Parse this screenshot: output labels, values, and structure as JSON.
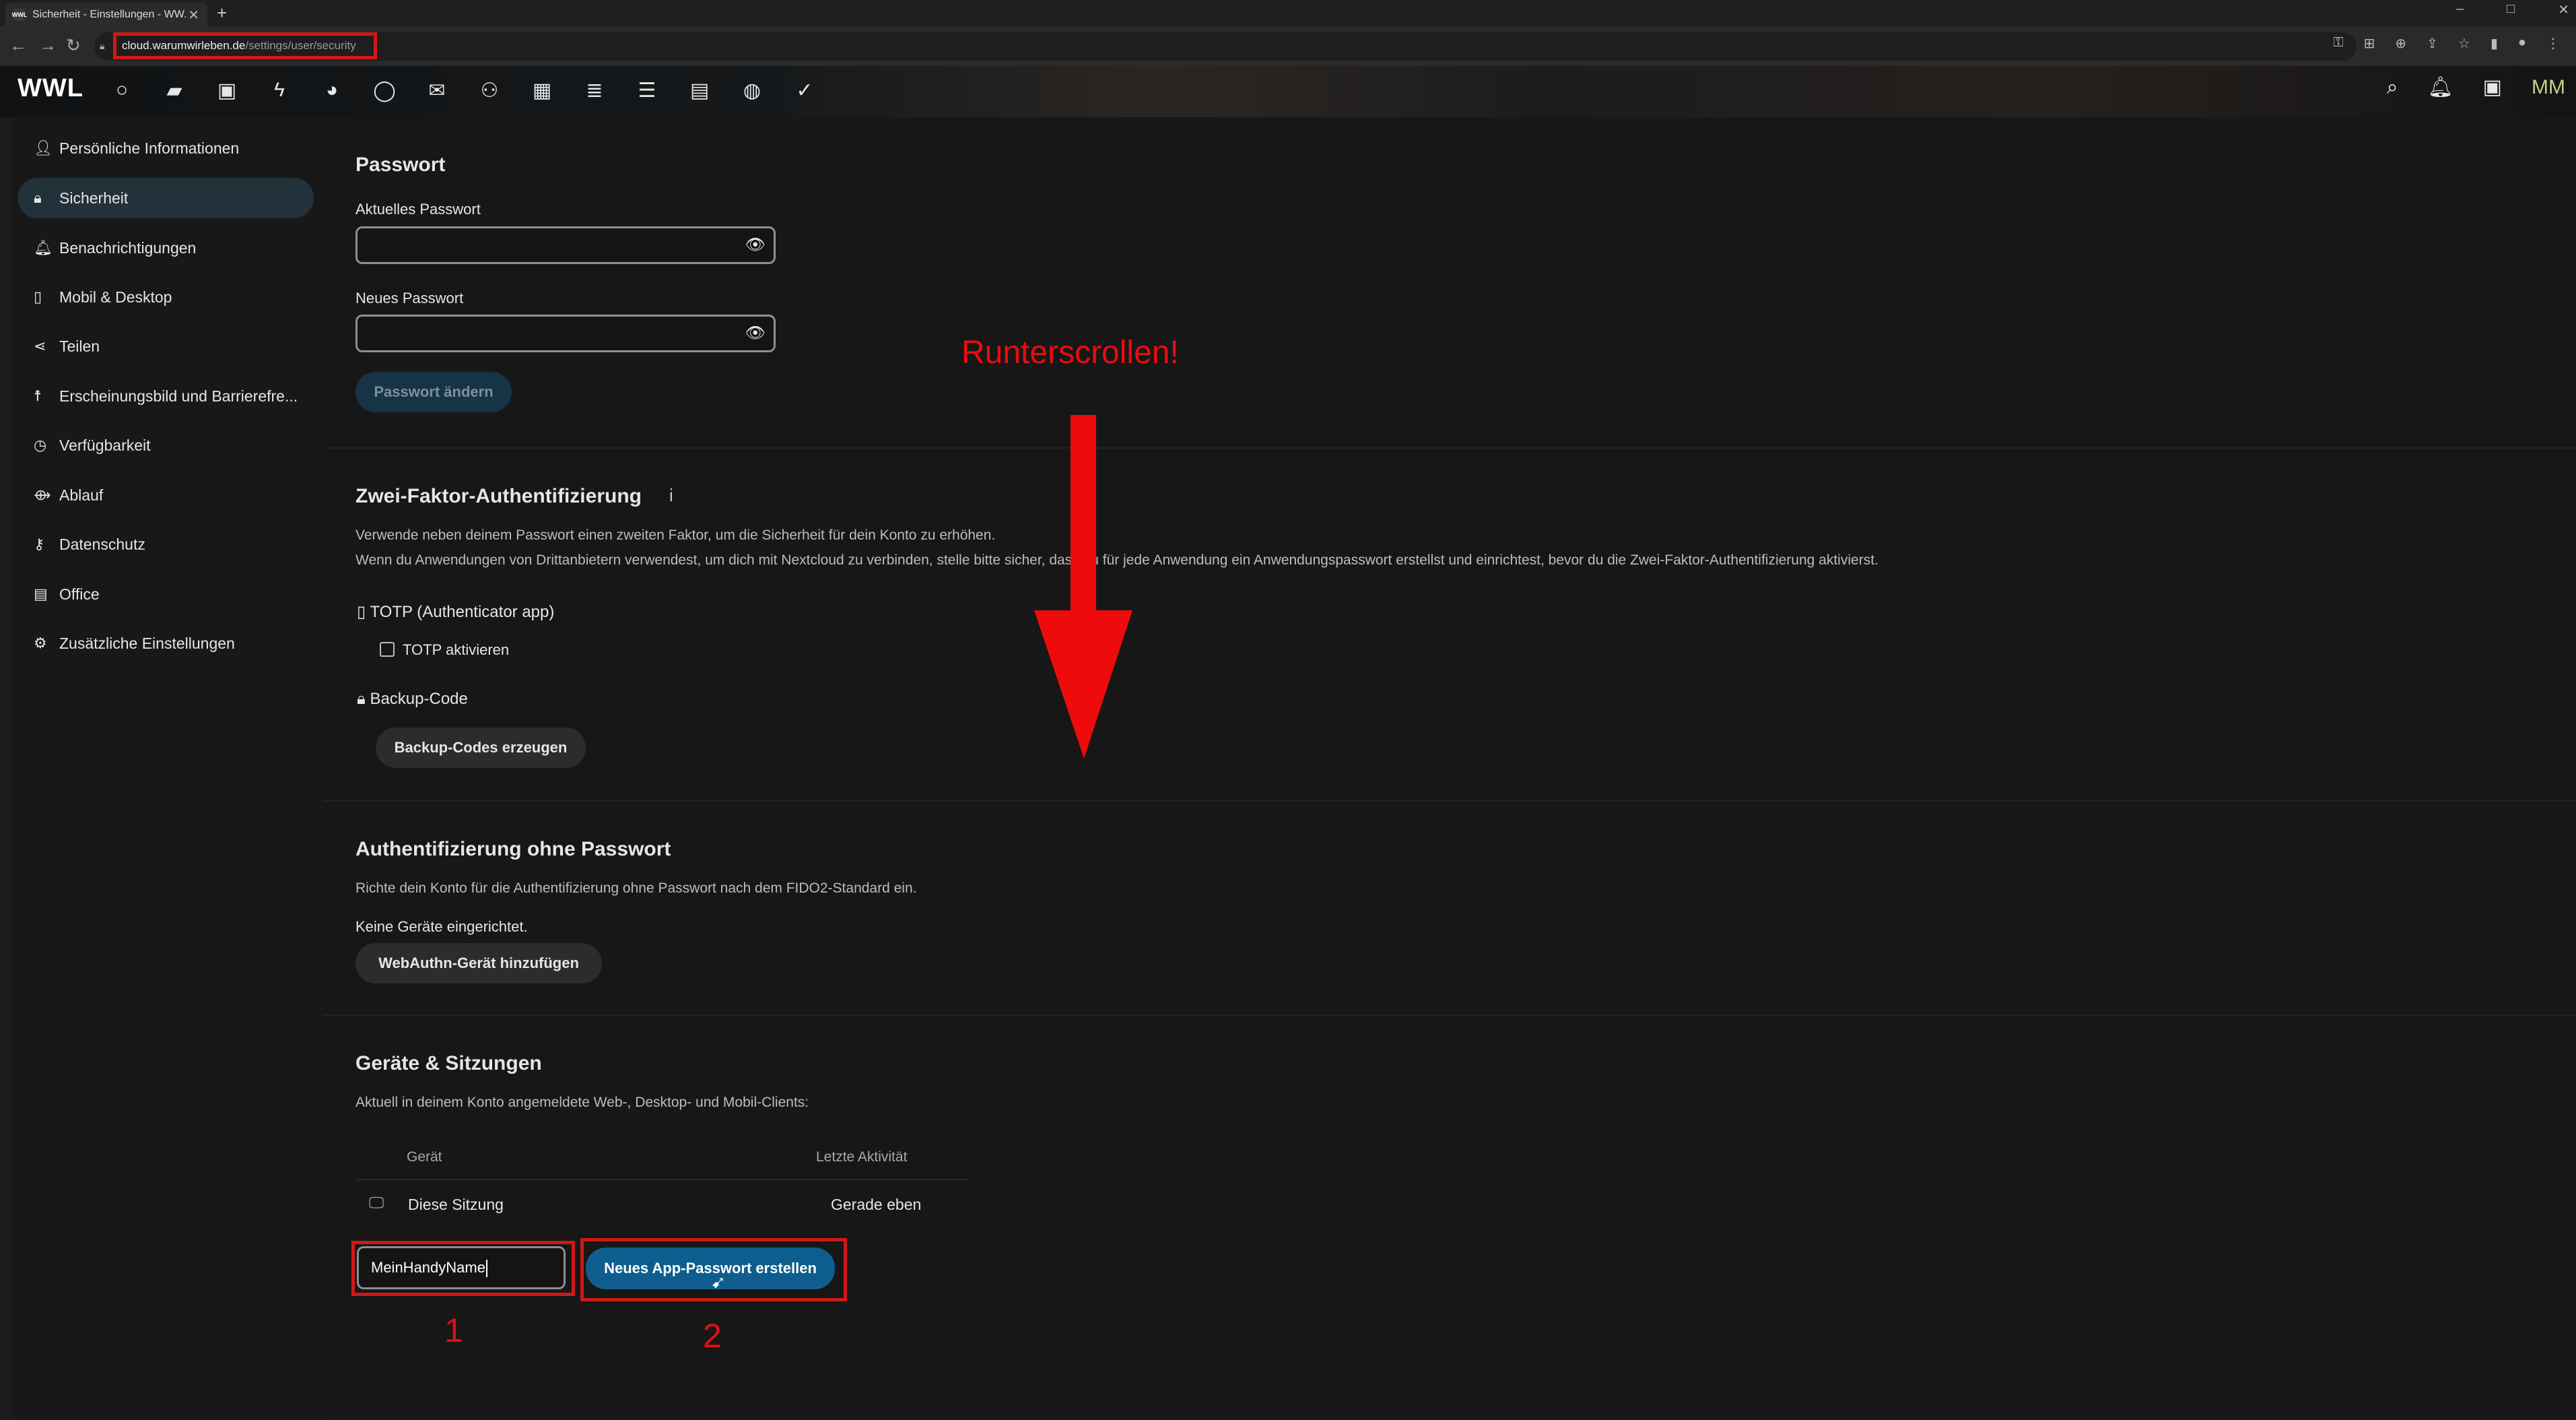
{
  "browser": {
    "tab_title": "Sicherheit - Einstellungen - WW...",
    "tab_favicon": "WWL",
    "url_host": "cloud.warumwirleben.de",
    "url_path": "/settings/user/security"
  },
  "header": {
    "logo": "WWL",
    "avatar_initials": "MM",
    "app_icons": [
      "dashboard-icon",
      "files-icon",
      "photos-icon",
      "activity-icon",
      "tools-icon",
      "talk-icon",
      "mail-icon",
      "contacts-icon",
      "calendar-icon",
      "deck-icon",
      "tasks-icon",
      "notes-icon",
      "maps-icon",
      "checkmark-icon"
    ]
  },
  "sidebar": {
    "items": [
      {
        "label": "Persönliche Informationen",
        "icon": "person-icon"
      },
      {
        "label": "Sicherheit",
        "icon": "lock-icon"
      },
      {
        "label": "Benachrichtigungen",
        "icon": "bell-icon"
      },
      {
        "label": "Mobil & Desktop",
        "icon": "phone-icon"
      },
      {
        "label": "Teilen",
        "icon": "share-icon"
      },
      {
        "label": "Erscheinungsbild und Barrierefre...",
        "icon": "accessibility-icon"
      },
      {
        "label": "Verfügbarkeit",
        "icon": "clock-icon"
      },
      {
        "label": "Ablauf",
        "icon": "workflow-icon"
      },
      {
        "label": "Datenschutz",
        "icon": "key-icon"
      },
      {
        "label": "Office",
        "icon": "document-icon"
      },
      {
        "label": "Zusätzliche Einstellungen",
        "icon": "gear-icon"
      }
    ]
  },
  "password": {
    "heading": "Passwort",
    "current_label": "Aktuelles Passwort",
    "new_label": "Neues Passwort",
    "change_button": "Passwort ändern"
  },
  "twofactor": {
    "heading": "Zwei-Faktor-Authentifizierung",
    "info_glyph": "i",
    "desc1": "Verwende neben deinem Passwort einen zweiten Faktor, um die Sicherheit für dein Konto zu erhöhen.",
    "desc2": "Wenn du Anwendungen von Drittanbietern verwendest, um dich mit Nextcloud zu verbinden, stelle bitte sicher, dass du für jede Anwendung ein Anwendungspasswort erstellst und einrichtest, bevor du die Zwei-Faktor-Authentifizierung aktivierst.",
    "totp_title": "TOTP (Authenticator app)",
    "totp_checkbox": "TOTP aktivieren",
    "backup_title": "Backup-Code",
    "backup_button": "Backup-Codes erzeugen"
  },
  "passwordless": {
    "heading": "Authentifizierung ohne Passwort",
    "desc": "Richte dein Konto für die Authentifizierung ohne Passwort nach dem FIDO2-Standard ein.",
    "none": "Keine Geräte eingerichtet.",
    "button": "WebAuthn-Gerät hinzufügen"
  },
  "devices": {
    "heading": "Geräte & Sitzungen",
    "desc": "Aktuell in deinem Konto angemeldete Web-, Desktop- und Mobil-Clients:",
    "col_device": "Gerät",
    "col_activity": "Letzte Aktivität",
    "rows": [
      {
        "device": "Diese Sitzung",
        "activity": "Gerade eben"
      }
    ],
    "app_name_value": "MeinHandyName",
    "create_button": "Neues App-Passwort erstellen"
  },
  "annotations": {
    "callout": "Runterscrollen!",
    "step1": "1",
    "step2": "2",
    "color": "#e01010"
  }
}
